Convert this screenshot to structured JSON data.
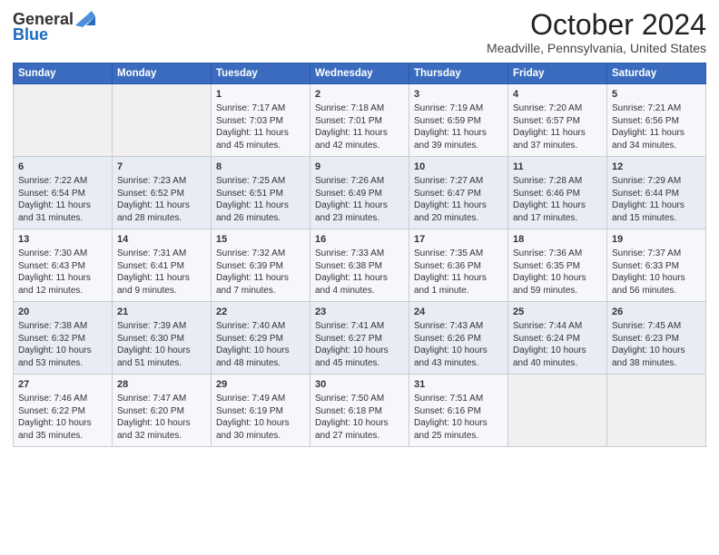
{
  "logo": {
    "general": "General",
    "blue": "Blue"
  },
  "title": "October 2024",
  "subtitle": "Meadville, Pennsylvania, United States",
  "days_of_week": [
    "Sunday",
    "Monday",
    "Tuesday",
    "Wednesday",
    "Thursday",
    "Friday",
    "Saturday"
  ],
  "weeks": [
    [
      {
        "day": "",
        "sunrise": "",
        "sunset": "",
        "daylight": ""
      },
      {
        "day": "",
        "sunrise": "",
        "sunset": "",
        "daylight": ""
      },
      {
        "day": "1",
        "sunrise": "Sunrise: 7:17 AM",
        "sunset": "Sunset: 7:03 PM",
        "daylight": "Daylight: 11 hours and 45 minutes."
      },
      {
        "day": "2",
        "sunrise": "Sunrise: 7:18 AM",
        "sunset": "Sunset: 7:01 PM",
        "daylight": "Daylight: 11 hours and 42 minutes."
      },
      {
        "day": "3",
        "sunrise": "Sunrise: 7:19 AM",
        "sunset": "Sunset: 6:59 PM",
        "daylight": "Daylight: 11 hours and 39 minutes."
      },
      {
        "day": "4",
        "sunrise": "Sunrise: 7:20 AM",
        "sunset": "Sunset: 6:57 PM",
        "daylight": "Daylight: 11 hours and 37 minutes."
      },
      {
        "day": "5",
        "sunrise": "Sunrise: 7:21 AM",
        "sunset": "Sunset: 6:56 PM",
        "daylight": "Daylight: 11 hours and 34 minutes."
      }
    ],
    [
      {
        "day": "6",
        "sunrise": "Sunrise: 7:22 AM",
        "sunset": "Sunset: 6:54 PM",
        "daylight": "Daylight: 11 hours and 31 minutes."
      },
      {
        "day": "7",
        "sunrise": "Sunrise: 7:23 AM",
        "sunset": "Sunset: 6:52 PM",
        "daylight": "Daylight: 11 hours and 28 minutes."
      },
      {
        "day": "8",
        "sunrise": "Sunrise: 7:25 AM",
        "sunset": "Sunset: 6:51 PM",
        "daylight": "Daylight: 11 hours and 26 minutes."
      },
      {
        "day": "9",
        "sunrise": "Sunrise: 7:26 AM",
        "sunset": "Sunset: 6:49 PM",
        "daylight": "Daylight: 11 hours and 23 minutes."
      },
      {
        "day": "10",
        "sunrise": "Sunrise: 7:27 AM",
        "sunset": "Sunset: 6:47 PM",
        "daylight": "Daylight: 11 hours and 20 minutes."
      },
      {
        "day": "11",
        "sunrise": "Sunrise: 7:28 AM",
        "sunset": "Sunset: 6:46 PM",
        "daylight": "Daylight: 11 hours and 17 minutes."
      },
      {
        "day": "12",
        "sunrise": "Sunrise: 7:29 AM",
        "sunset": "Sunset: 6:44 PM",
        "daylight": "Daylight: 11 hours and 15 minutes."
      }
    ],
    [
      {
        "day": "13",
        "sunrise": "Sunrise: 7:30 AM",
        "sunset": "Sunset: 6:43 PM",
        "daylight": "Daylight: 11 hours and 12 minutes."
      },
      {
        "day": "14",
        "sunrise": "Sunrise: 7:31 AM",
        "sunset": "Sunset: 6:41 PM",
        "daylight": "Daylight: 11 hours and 9 minutes."
      },
      {
        "day": "15",
        "sunrise": "Sunrise: 7:32 AM",
        "sunset": "Sunset: 6:39 PM",
        "daylight": "Daylight: 11 hours and 7 minutes."
      },
      {
        "day": "16",
        "sunrise": "Sunrise: 7:33 AM",
        "sunset": "Sunset: 6:38 PM",
        "daylight": "Daylight: 11 hours and 4 minutes."
      },
      {
        "day": "17",
        "sunrise": "Sunrise: 7:35 AM",
        "sunset": "Sunset: 6:36 PM",
        "daylight": "Daylight: 11 hours and 1 minute."
      },
      {
        "day": "18",
        "sunrise": "Sunrise: 7:36 AM",
        "sunset": "Sunset: 6:35 PM",
        "daylight": "Daylight: 10 hours and 59 minutes."
      },
      {
        "day": "19",
        "sunrise": "Sunrise: 7:37 AM",
        "sunset": "Sunset: 6:33 PM",
        "daylight": "Daylight: 10 hours and 56 minutes."
      }
    ],
    [
      {
        "day": "20",
        "sunrise": "Sunrise: 7:38 AM",
        "sunset": "Sunset: 6:32 PM",
        "daylight": "Daylight: 10 hours and 53 minutes."
      },
      {
        "day": "21",
        "sunrise": "Sunrise: 7:39 AM",
        "sunset": "Sunset: 6:30 PM",
        "daylight": "Daylight: 10 hours and 51 minutes."
      },
      {
        "day": "22",
        "sunrise": "Sunrise: 7:40 AM",
        "sunset": "Sunset: 6:29 PM",
        "daylight": "Daylight: 10 hours and 48 minutes."
      },
      {
        "day": "23",
        "sunrise": "Sunrise: 7:41 AM",
        "sunset": "Sunset: 6:27 PM",
        "daylight": "Daylight: 10 hours and 45 minutes."
      },
      {
        "day": "24",
        "sunrise": "Sunrise: 7:43 AM",
        "sunset": "Sunset: 6:26 PM",
        "daylight": "Daylight: 10 hours and 43 minutes."
      },
      {
        "day": "25",
        "sunrise": "Sunrise: 7:44 AM",
        "sunset": "Sunset: 6:24 PM",
        "daylight": "Daylight: 10 hours and 40 minutes."
      },
      {
        "day": "26",
        "sunrise": "Sunrise: 7:45 AM",
        "sunset": "Sunset: 6:23 PM",
        "daylight": "Daylight: 10 hours and 38 minutes."
      }
    ],
    [
      {
        "day": "27",
        "sunrise": "Sunrise: 7:46 AM",
        "sunset": "Sunset: 6:22 PM",
        "daylight": "Daylight: 10 hours and 35 minutes."
      },
      {
        "day": "28",
        "sunrise": "Sunrise: 7:47 AM",
        "sunset": "Sunset: 6:20 PM",
        "daylight": "Daylight: 10 hours and 32 minutes."
      },
      {
        "day": "29",
        "sunrise": "Sunrise: 7:49 AM",
        "sunset": "Sunset: 6:19 PM",
        "daylight": "Daylight: 10 hours and 30 minutes."
      },
      {
        "day": "30",
        "sunrise": "Sunrise: 7:50 AM",
        "sunset": "Sunset: 6:18 PM",
        "daylight": "Daylight: 10 hours and 27 minutes."
      },
      {
        "day": "31",
        "sunrise": "Sunrise: 7:51 AM",
        "sunset": "Sunset: 6:16 PM",
        "daylight": "Daylight: 10 hours and 25 minutes."
      },
      {
        "day": "",
        "sunrise": "",
        "sunset": "",
        "daylight": ""
      },
      {
        "day": "",
        "sunrise": "",
        "sunset": "",
        "daylight": ""
      }
    ]
  ]
}
